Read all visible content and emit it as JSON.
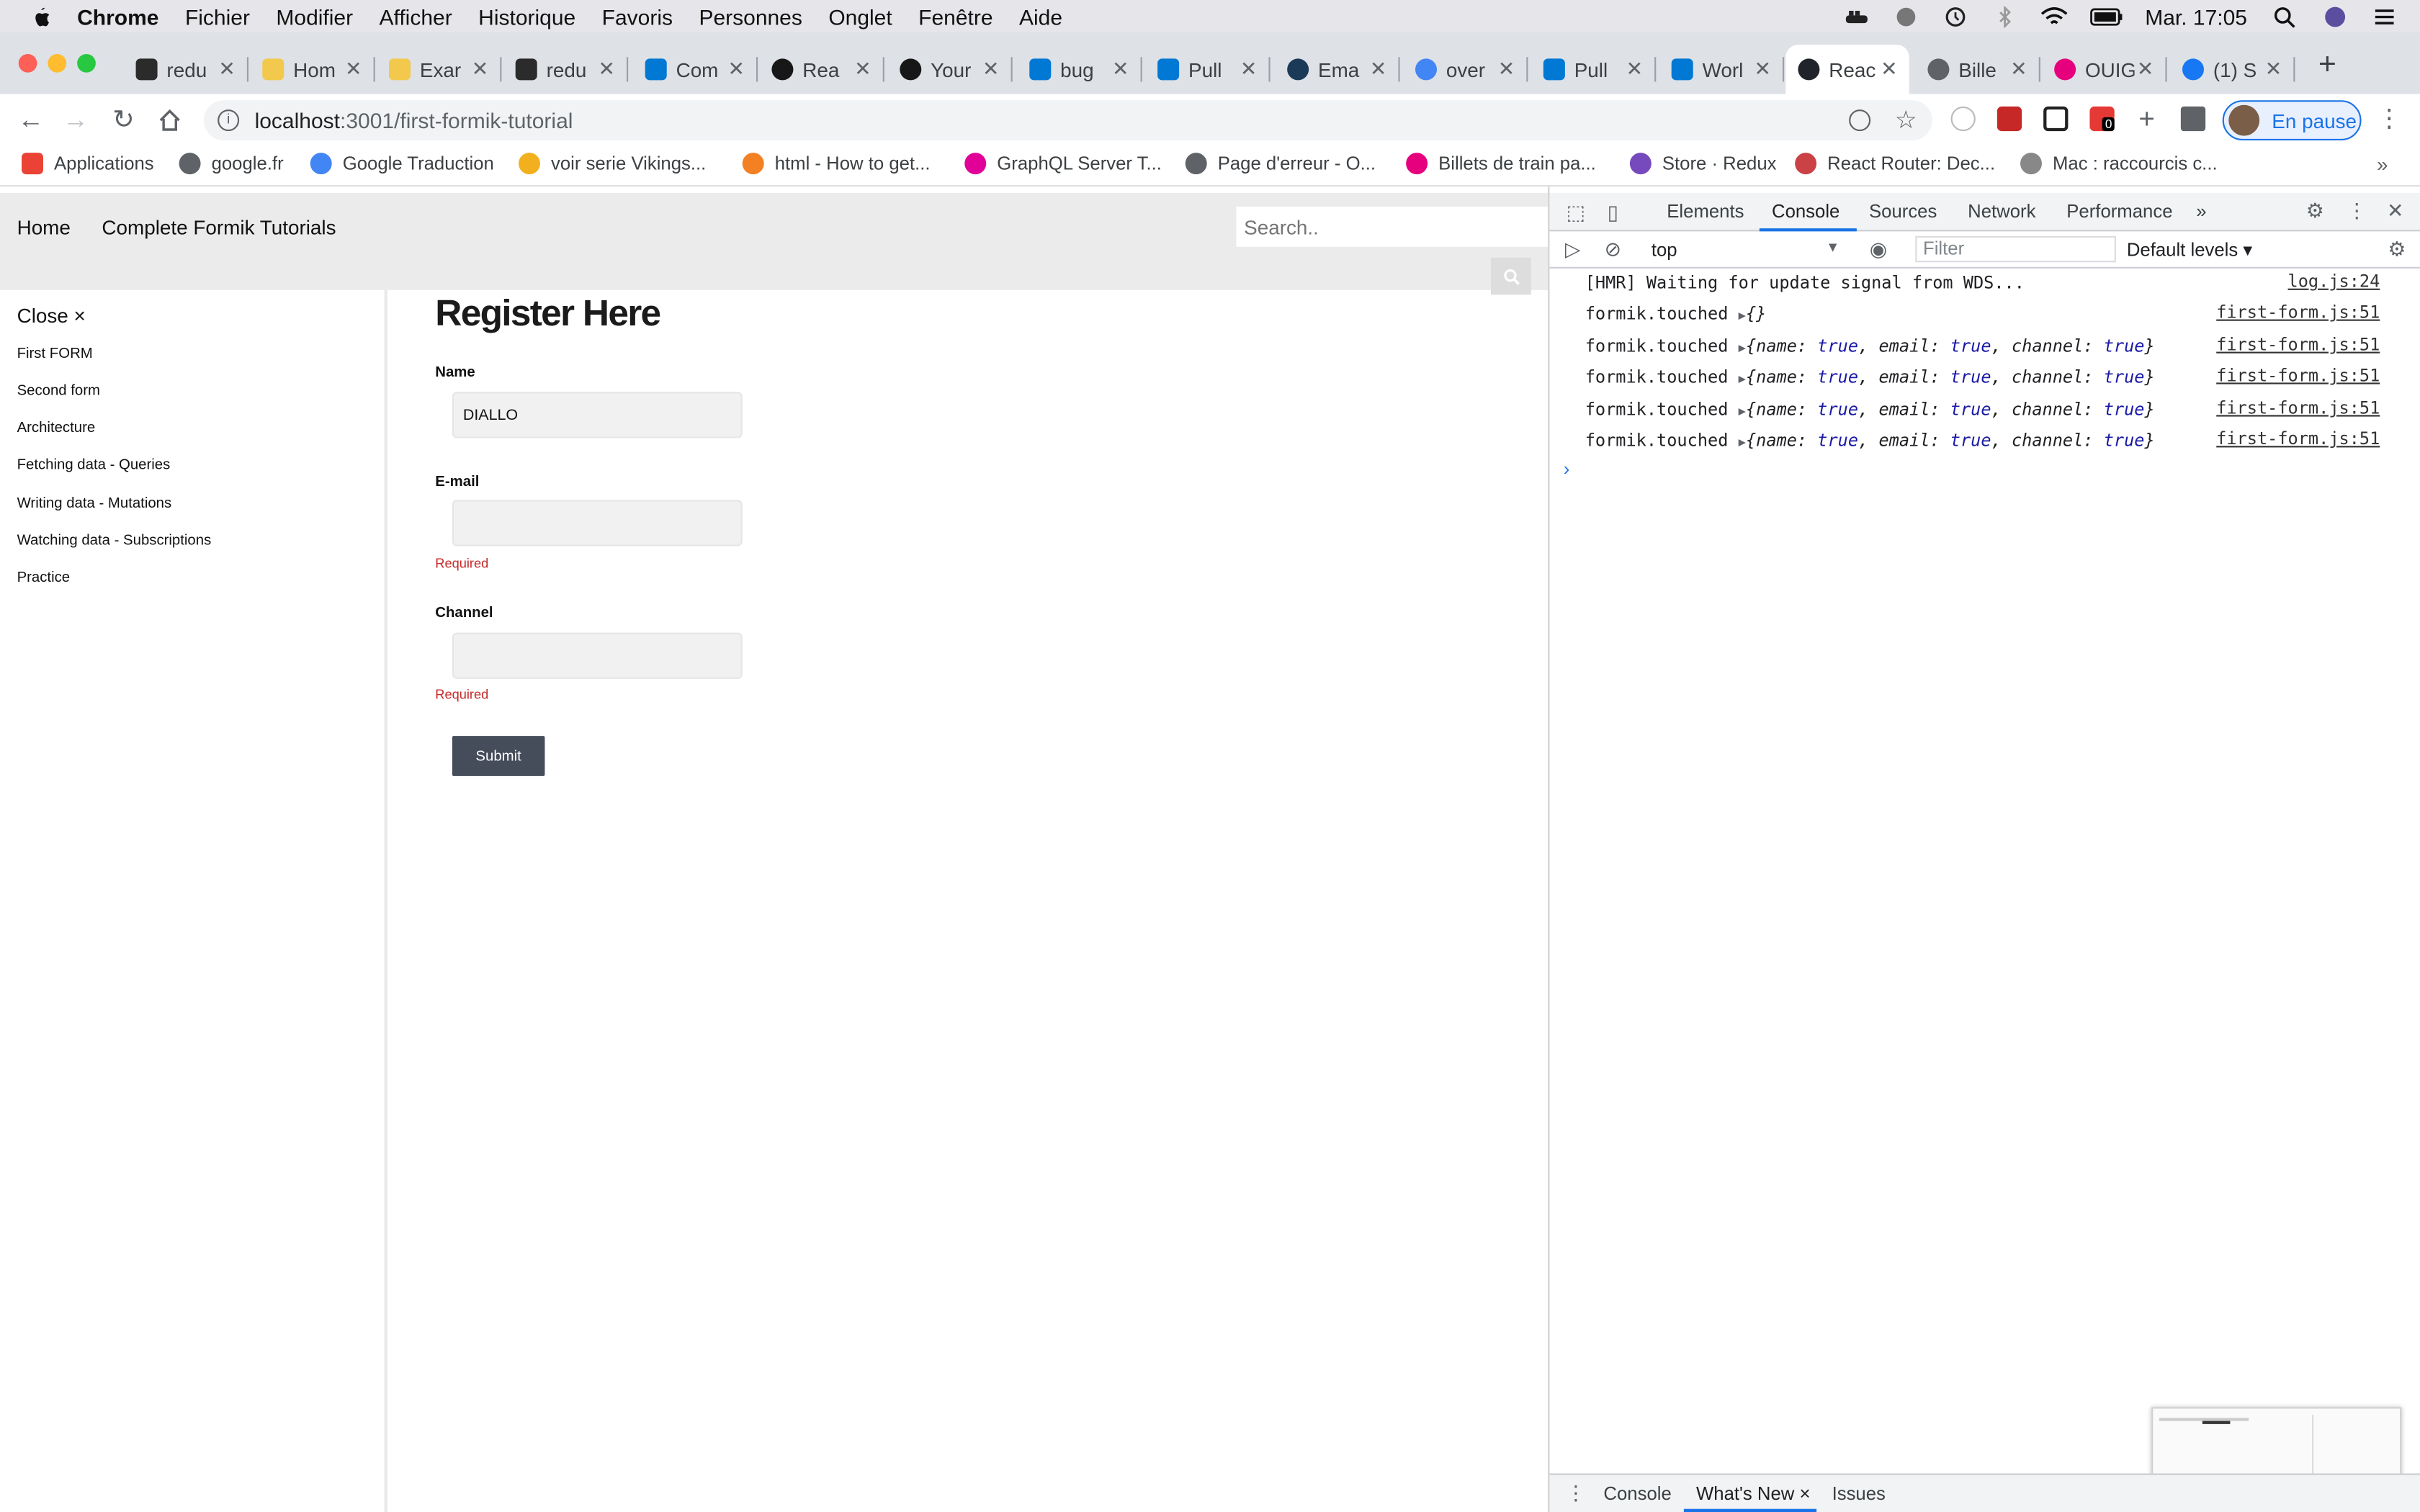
{
  "menubar": {
    "app_name": "Chrome",
    "items": [
      "Fichier",
      "Modifier",
      "Afficher",
      "Historique",
      "Favoris",
      "Personnes",
      "Onglet",
      "Fenêtre",
      "Aide"
    ],
    "clock": "Mar. 17:05"
  },
  "tabs": [
    {
      "title": "redu",
      "icon": "codesandbox-icon"
    },
    {
      "title": "Hom",
      "icon": "folder-icon"
    },
    {
      "title": "Exar",
      "icon": "folder-icon"
    },
    {
      "title": "redu",
      "icon": "codesandbox-icon"
    },
    {
      "title": "Com",
      "icon": "azure-devops-icon"
    },
    {
      "title": "Rea",
      "icon": "github-icon"
    },
    {
      "title": "Your",
      "icon": "github-icon"
    },
    {
      "title": "bug",
      "icon": "azure-devops-icon"
    },
    {
      "title": "Pull",
      "icon": "azure-devops-icon"
    },
    {
      "title": "Ema",
      "icon": "es-icon"
    },
    {
      "title": "over",
      "icon": "google-icon"
    },
    {
      "title": "Pull",
      "icon": "azure-devops-icon"
    },
    {
      "title": "Worl",
      "icon": "azure-devops-icon"
    },
    {
      "title": "Reac",
      "icon": "react-icon",
      "active": true
    },
    {
      "title": "Bille",
      "icon": "globe-icon"
    },
    {
      "title": "OUIG",
      "icon": "ouigo-icon"
    },
    {
      "title": "(1) S",
      "icon": "facebook-icon"
    }
  ],
  "toolbar": {
    "url_host": "localhost",
    "url_path": ":3001/first-formik-tutorial",
    "profile_label": "En pause",
    "extension_badge": "0"
  },
  "bookmarks": [
    {
      "label": "Applications",
      "icon": "apps-grid-icon"
    },
    {
      "label": "google.fr",
      "icon": "globe-icon"
    },
    {
      "label": "Google Traduction",
      "icon": "translate-icon"
    },
    {
      "label": "voir serie Vikings...",
      "icon": "sun-icon"
    },
    {
      "label": "html - How to get...",
      "icon": "stackoverflow-icon"
    },
    {
      "label": "GraphQL Server T...",
      "icon": "graphql-icon"
    },
    {
      "label": "Page d'erreur - O...",
      "icon": "globe-icon"
    },
    {
      "label": "Billets de train pa...",
      "icon": "ouigo-icon"
    },
    {
      "label": "Store · Redux",
      "icon": "redux-icon"
    },
    {
      "label": "React Router: Dec...",
      "icon": "react-router-icon"
    },
    {
      "label": "Mac : raccourcis c...",
      "icon": "apple-icon"
    }
  ],
  "page": {
    "nav": {
      "home": "Home",
      "tutorials": "Complete Formik Tutorials"
    },
    "search_placeholder": "Search..",
    "sidebar": {
      "close_label": "Close ×",
      "items": [
        "First FORM",
        "Second form",
        "Architecture",
        "Fetching data - Queries",
        "Writing data - Mutations",
        "Watching data - Subscriptions",
        "Practice"
      ]
    },
    "form": {
      "title": "Register Here",
      "name_label": "Name",
      "name_value": "DIALLO",
      "email_label": "E-mail",
      "email_value": "",
      "email_error": "Required",
      "channel_label": "Channel",
      "channel_value": "",
      "channel_error": "Required",
      "submit_label": "Submit"
    }
  },
  "devtools": {
    "tabs": [
      "Elements",
      "Console",
      "Sources",
      "Network",
      "Performance"
    ],
    "active_tab": "Console",
    "context": "top",
    "filter_placeholder": "Filter",
    "levels": "Default levels ▾",
    "console": [
      {
        "label": "[HMR] Waiting for update signal from WDS...",
        "source": "log.js:24"
      },
      {
        "label": "formik.touched",
        "object": "{}",
        "source": "first-form.js:51"
      },
      {
        "label": "formik.touched",
        "object": "{name: true, email: true, channel: true}",
        "source": "first-form.js:51"
      },
      {
        "label": "formik.touched",
        "object": "{name: true, email: true, channel: true}",
        "source": "first-form.js:51"
      },
      {
        "label": "formik.touched",
        "object": "{name: true, email: true, channel: true}",
        "source": "first-form.js:51"
      },
      {
        "label": "formik.touched",
        "object": "{name: true, email: true, channel: true}",
        "source": "first-form.js:51"
      }
    ],
    "drawer_tabs": [
      "Console",
      "What's New ×",
      "Issues"
    ],
    "drawer_active": "What's New"
  },
  "colors": {
    "accent": "#1a73e8",
    "error": "#c62828",
    "submit_bg": "#454c5a",
    "nav_bg": "#ebebeb"
  }
}
